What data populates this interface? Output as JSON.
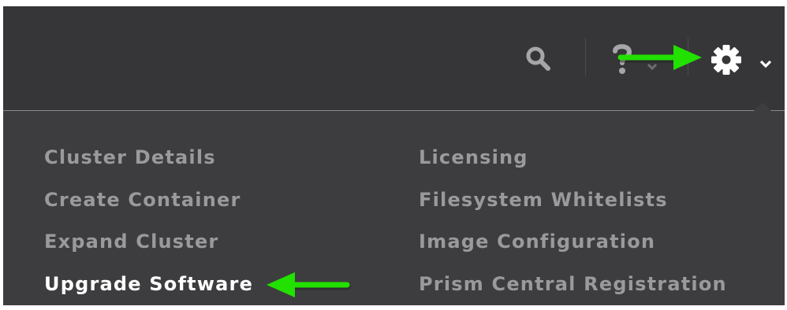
{
  "header": {
    "icons": [
      "search-icon",
      "help-icon",
      "gear-icon",
      "chevron-down-icon"
    ]
  },
  "settings_menu": {
    "left_column": [
      {
        "label": "Cluster Details"
      },
      {
        "label": "Create Container"
      },
      {
        "label": "Expand Cluster"
      },
      {
        "label": "Upgrade Software",
        "highlighted": true
      }
    ],
    "right_column": [
      {
        "label": "Licensing"
      },
      {
        "label": "Filesystem Whitelists"
      },
      {
        "label": "Image Configuration"
      },
      {
        "label": "Prism Central Registration"
      }
    ]
  },
  "annotations": {
    "arrow_color": "#22e000",
    "arrows": [
      "arrow-to-gear-icon",
      "arrow-to-upgrade-software"
    ]
  },
  "colors": {
    "topbar": "#363638",
    "menu_background": "#3d3d3f",
    "menu_text": "#9a9a9c",
    "menu_text_active": "#ffffff"
  }
}
